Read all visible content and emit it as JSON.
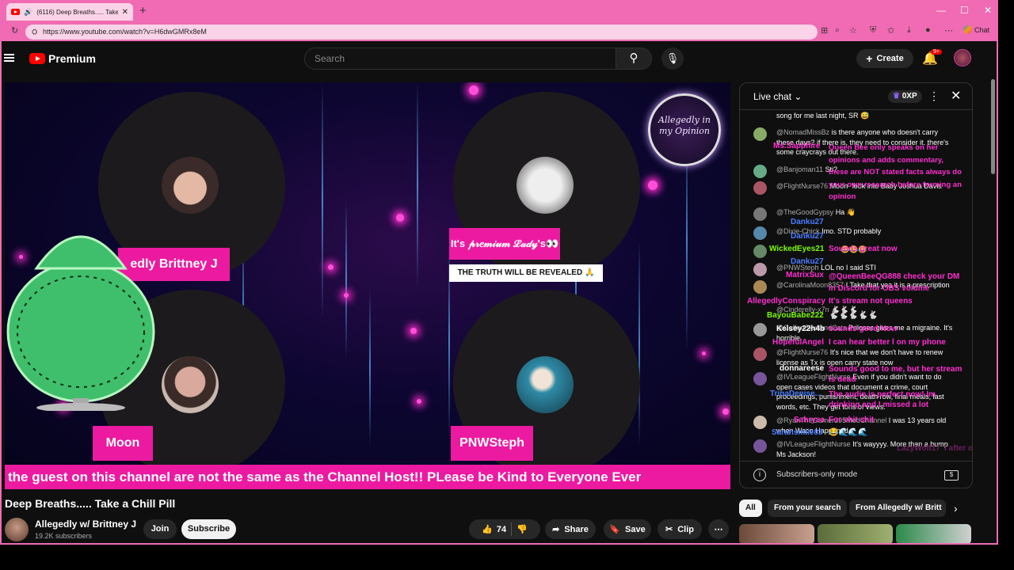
{
  "browser": {
    "tab_title": "(6116) Deep Breaths..... Take a",
    "url": "https://www.youtube.com/watch?v=H6dwGMRx8eM",
    "chat_ext_label": "Chat"
  },
  "header": {
    "brand": "Premium",
    "search_placeholder": "Search",
    "create_label": "Create",
    "notif_badge": "9+"
  },
  "video": {
    "guest_tags": [
      "edly Brittney J",
      "Moon",
      "PNWSteph"
    ],
    "banner_top": "It's 𝓅𝓇𝑒𝓂𝒾𝓊𝓂 ℒ𝒶𝒹𝓎's👀",
    "banner_truth": "THE TRUTH WILL BE REVEALED 🙏",
    "logo_text": "Allegedly in my Opinion",
    "ticker": "the guest on this channel are not the same as the Channel Host!! PLease be Kind to Everyone Ever",
    "title": "Deep Breaths..... Take a Chill Pill"
  },
  "channel": {
    "name": "Allegedly w/ Brittney J",
    "subs": "19.2K subscribers",
    "join_label": "Join",
    "subscribe_label": "Subscribe"
  },
  "actions": {
    "likes": "74",
    "share_label": "Share",
    "save_label": "Save",
    "clip_label": "Clip"
  },
  "chat": {
    "title": "Live chat",
    "xp": "0XP",
    "footer_mode": "Subscribers-only mode",
    "messages": [
      {
        "author": "",
        "text": "song for me last night, SR 😅"
      },
      {
        "author": "@NomadMissBz",
        "text": "is there anyone who doesn't carry these days? if there is, they need to consider it. there's some craycrays out there."
      },
      {
        "author": "@Banjoman11",
        "text": "Sti?"
      },
      {
        "author": "@FlightNurse76",
        "text": "Moon- look into Baby Joshua Davis"
      },
      {
        "author": "@TheGoodGypsy",
        "text": "Ha 👋"
      },
      {
        "author": "@Dixie-Chick",
        "text": "Imo. STD probably"
      },
      {
        "author": "",
        "text": "😂😂😂"
      },
      {
        "author": "@PNWSteph",
        "text": "LOL no I said STI"
      },
      {
        "author": "@CarolinaMoon8357",
        "text": "I Take that yea it is a prescription"
      },
      {
        "author": "@Cinderelly-x7n",
        "text": "🐇🐇🐇"
      },
      {
        "author": "@CoffeeSkullandCats",
        "text": "Prilosec gives me a migraine. It's horrible."
      },
      {
        "author": "@FlightNurse76",
        "text": "It's nice that we don't have to renew license as Tx is open carry state now"
      },
      {
        "author": "@IVLeagueFlightNurse",
        "text": "Even if you didn't want to do open cases videos that document a crime, court proceedings, punishment, death row, final meals, last words, etc. They get tons of views."
      },
      {
        "author": "@RyanTheGamer395ModChannel",
        "text": "I was 13 years old when Waco Happened"
      },
      {
        "author": "@IVLeagueFlightNurse",
        "text": "It's wayyyy. More than a bump Ms Jackson!"
      }
    ],
    "overlays": [
      {
        "name": "Ms.Sapphire",
        "text": "Queen Bee only speaks on her opinions and adds commentary, these are NOT stated facts always do your own research before forming an opinion"
      },
      {
        "name": "Danku27",
        "text": ""
      },
      {
        "name": "Danku27",
        "text": ""
      },
      {
        "name": "WickedEyes21",
        "text": "Sounds great now"
      },
      {
        "name": "Danku27",
        "text": ""
      },
      {
        "name": "MatrixSux",
        "text": "@QueenBeeQG888 check your DM in Discord for OBS volume"
      },
      {
        "name": "AllegedlyConspiracy",
        "text": "It's stream not queens"
      },
      {
        "name": "BayouBabe222",
        "text": "🐇🐇🐇🐇🐇"
      },
      {
        "name": "Kelsey22h4b",
        "text": "sounds good Now"
      },
      {
        "name": "HopefulAngel",
        "text": "I can hear better l on my phone"
      },
      {
        "name": "donnareese",
        "text": "Sounds good to me, but her stream is dead"
      },
      {
        "name": "TrinaDenise...",
        "text": "The audio is perfect now! Im drinking and I missed a lot"
      },
      {
        "name": "Sahrysa",
        "text": "For shit shit"
      },
      {
        "name": "Sarahsmile83",
        "text": "😂🌊🌊🌊"
      },
      {
        "name": "LazyWolf17",
        "text": "I after older"
      }
    ]
  },
  "chips": [
    "All",
    "From your search",
    "From Allegedly w/ Britt"
  ],
  "colors": {
    "accent": "#ec1aa0",
    "browser": "#f06bb3",
    "overlay_pink": "#ff2fd0",
    "overlay_green": "#7CFC00",
    "overlay_blue": "#4b7cff"
  }
}
